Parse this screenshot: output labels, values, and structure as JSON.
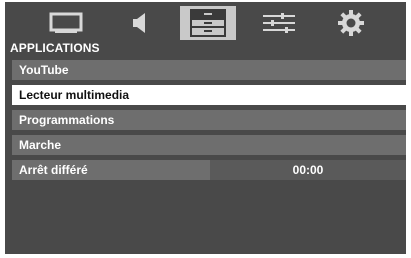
{
  "tabs": [
    {
      "icon": "tv-screen-icon",
      "active": false
    },
    {
      "icon": "speaker-icon",
      "active": false
    },
    {
      "icon": "list-menu-icon",
      "active": true
    },
    {
      "icon": "sliders-icon",
      "active": false
    },
    {
      "icon": "gear-icon",
      "active": false
    }
  ],
  "section_title": "APPLICATIONS",
  "menu": {
    "items": [
      {
        "label": "YouTube"
      },
      {
        "label": "Lecteur multimedia"
      },
      {
        "label": "Programmations"
      },
      {
        "label": "Marche"
      },
      {
        "label": "Arrêt différé",
        "value": "00:00"
      }
    ]
  },
  "colors": {
    "background": "#494949",
    "item": "#6e6e6e",
    "selected_item": "#ffffff",
    "active_tab": "#c9c9c9"
  }
}
